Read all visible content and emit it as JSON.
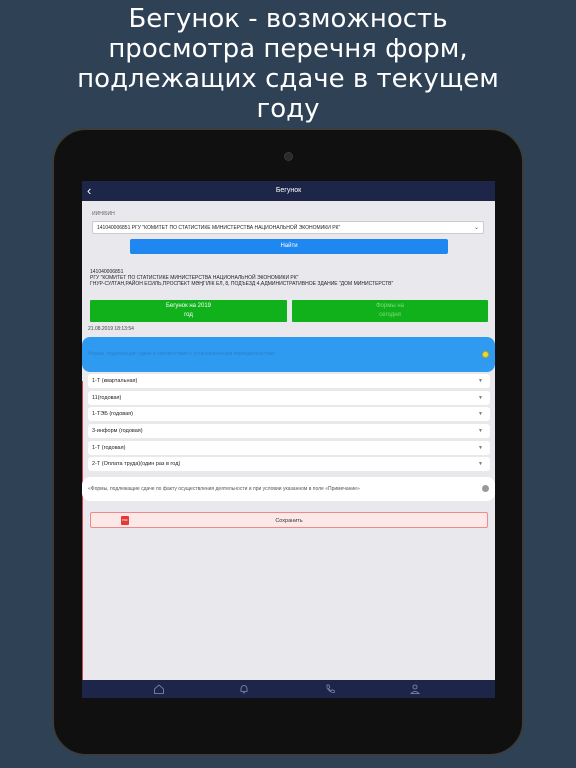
{
  "headline": [
    "Бегунок - возможность",
    "просмотра перечня форм,",
    "подлежащих сдаче в текущем",
    "году"
  ],
  "nav": {
    "title": "Бегунок",
    "back_icon": "chevron-left-icon"
  },
  "search": {
    "label": "ИИН/БИН",
    "value": "141040006851 РГУ \"КОМИТЕТ ПО СТАТИСТИКЕ МИНИСТЕРСТВА НАЦИОНАЛЬНОЙ ЭКОНОМИКИ РК\"",
    "find_label": "Найти"
  },
  "org": {
    "bin": "141040006851",
    "name": "РГУ \"КОМИТЕТ ПО СТАТИСТИКЕ МИНИСТЕРСТВА НАЦИОНАЛЬНОЙ ЭКОНОМИКИ РК\"",
    "address": "ГНУР-СУЛТАН,РАЙОН ЕСИЛЬ,ПРОСПЕКТ МӘҢГІЛІК ЕЛ, 8, ПОДЪЕЗД 4,АДМИНИСТРАТИВНОЕ ЗДАНИЕ \"ДОМ МИНИСТЕРСТВ\""
  },
  "buttons": {
    "begunok_line1": "Бегунок на 2019",
    "begunok_line2": "год",
    "forms_line1": "Формы на",
    "forms_line2": "сегодня"
  },
  "timestamp": "21.08.2019 18:13:54",
  "section1": {
    "text": "Формы, подлежащие сдаче в соответствии с установленными периодичностями"
  },
  "forms": [
    "1-Т (квартальная)",
    "11(годовая)",
    "1-ТЭБ (годовая)",
    "3-информ (годовая)",
    "1-Т (годовая)",
    "2-Т (Оплата труда)(один раз в год)"
  ],
  "section2": {
    "text": "«Формы, подлежащие сдаче по факту осуществления деятельности и при условии указанном в поле «Примечание»"
  },
  "save": {
    "label": "Сохранить",
    "pdf": "PDF"
  },
  "colors": {
    "nav": "#1d2648",
    "find": "#1e88f0",
    "green": "#11b11b",
    "blue_bar": "#2e9bf1"
  }
}
